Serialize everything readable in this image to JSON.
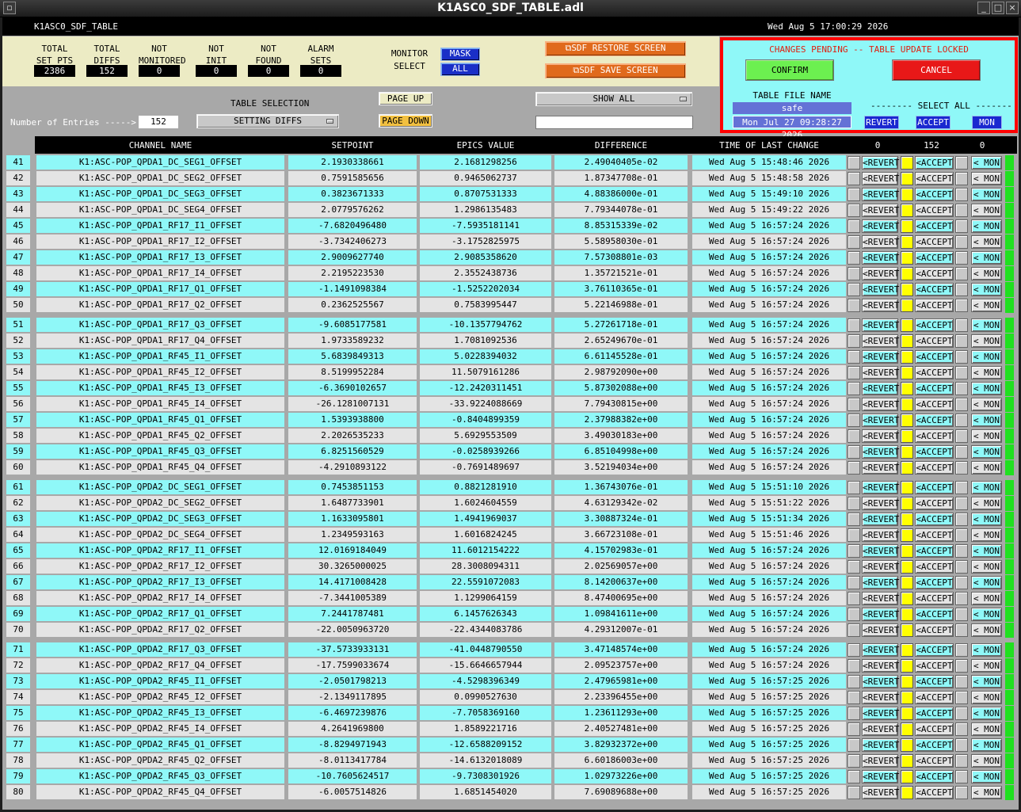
{
  "window": {
    "title": "K1ASC0_SDF_TABLE.adl"
  },
  "header": {
    "screen_name": "K1ASC0_SDF_TABLE",
    "datetime": "Wed Aug  5 17:00:29 2026"
  },
  "stats": [
    {
      "label": "TOTAL\nSET PTS",
      "value": "2386"
    },
    {
      "label": "TOTAL\nDIFFS",
      "value": "152"
    },
    {
      "label": "NOT\nMONITORED",
      "value": "0"
    },
    {
      "label": "NOT\nINIT",
      "value": "0"
    },
    {
      "label": "NOT\nFOUND",
      "value": "0"
    },
    {
      "label": "ALARM\nSETS",
      "value": "0"
    }
  ],
  "monitor": {
    "label": "MONITOR\nSELECT",
    "mask": "MASK",
    "all": "ALL"
  },
  "sdf_buttons": {
    "restore": "SDF RESTORE SCREEN",
    "save": "SDF SAVE SCREEN"
  },
  "pending": {
    "message": "CHANGES PENDING -- TABLE UPDATE LOCKED",
    "confirm": "CONFIRM",
    "cancel": "CANCEL",
    "table_file_label": "TABLE FILE NAME",
    "table_file": "safe",
    "table_file_date": "Mon Jul 27 09:28:27 2026",
    "select_all": "-------- SELECT ALL --------",
    "revert": "REVERT",
    "accept": "ACCEPT",
    "mon": "MON"
  },
  "table_controls": {
    "entries_label": "Number of Entries ----->",
    "entries_value": "152",
    "selection_label": "TABLE SELECTION",
    "selection_value": "SETTING DIFFS",
    "page_up": "PAGE UP",
    "page_down": "PAGE DOWN",
    "show_value": "SHOW ALL",
    "filter_value": ""
  },
  "columns": {
    "name": "CHANNEL NAME",
    "setpoint": "SETPOINT",
    "epics": "EPICS VALUE",
    "difference": "DIFFERENCE",
    "time": "TIME OF LAST CHANGE",
    "count_revert": "0",
    "count_accept": "152",
    "count_mon": "0"
  },
  "row_buttons": {
    "revert": "<REVERT",
    "accept": "<ACCEPT",
    "mon": "< MON"
  },
  "colors": {
    "cyan": "#8ff8f8",
    "gray": "#e4e4e4",
    "yellow": "#ffff00",
    "green": "#20e020",
    "red": "#ff0000",
    "orange": "#e06a1c",
    "blue": "#1a2fc7"
  },
  "rows": [
    {
      "num": "41",
      "name": "K1:ASC-POP_QPDA1_DC_SEG1_OFFSET",
      "setpoint": "2.1930338661",
      "epics": "2.1681298256",
      "diff": "2.49040405e-02",
      "time": "Wed Aug  5 15:48:46 2026",
      "accept": true,
      "rev_on": false,
      "acc_on": true,
      "mon_on": true
    },
    {
      "num": "42",
      "name": "K1:ASC-POP_QPDA1_DC_SEG2_OFFSET",
      "setpoint": "0.7591585656",
      "epics": "0.9465062737",
      "diff": "1.87347708e-01",
      "time": "Wed Aug  5 15:48:58 2026",
      "accept": true,
      "rev_on": false,
      "acc_on": false,
      "mon_on": false
    },
    {
      "num": "43",
      "name": "K1:ASC-POP_QPDA1_DC_SEG3_OFFSET",
      "setpoint": "0.3823671333",
      "epics": "0.8707531333",
      "diff": "4.88386000e-01",
      "time": "Wed Aug  5 15:49:10 2026",
      "accept": true,
      "rev_on": false,
      "acc_on": true,
      "mon_on": true
    },
    {
      "num": "44",
      "name": "K1:ASC-POP_QPDA1_DC_SEG4_OFFSET",
      "setpoint": "2.0779576262",
      "epics": "1.2986135483",
      "diff": "7.79344078e-01",
      "time": "Wed Aug  5 15:49:22 2026",
      "accept": true,
      "rev_on": false,
      "acc_on": false,
      "mon_on": false
    },
    {
      "num": "45",
      "name": "K1:ASC-POP_QPDA1_RF17_I1_OFFSET",
      "setpoint": "-7.6820496480",
      "epics": "-7.5935181141",
      "diff": "8.85315339e-02",
      "time": "Wed Aug  5 16:57:24 2026",
      "accept": true,
      "rev_on": false,
      "acc_on": true,
      "mon_on": true
    },
    {
      "num": "46",
      "name": "K1:ASC-POP_QPDA1_RF17_I2_OFFSET",
      "setpoint": "-3.7342406273",
      "epics": "-3.1752825975",
      "diff": "5.58958030e-01",
      "time": "Wed Aug  5 16:57:24 2026",
      "accept": true,
      "rev_on": false,
      "acc_on": false,
      "mon_on": false
    },
    {
      "num": "47",
      "name": "K1:ASC-POP_QPDA1_RF17_I3_OFFSET",
      "setpoint": "2.9009627740",
      "epics": "2.9085358620",
      "diff": "7.57308801e-03",
      "time": "Wed Aug  5 16:57:24 2026",
      "accept": true,
      "rev_on": false,
      "acc_on": true,
      "mon_on": true
    },
    {
      "num": "48",
      "name": "K1:ASC-POP_QPDA1_RF17_I4_OFFSET",
      "setpoint": "2.2195223530",
      "epics": "2.3552438736",
      "diff": "1.35721521e-01",
      "time": "Wed Aug  5 16:57:24 2026",
      "accept": true,
      "rev_on": false,
      "acc_on": false,
      "mon_on": false
    },
    {
      "num": "49",
      "name": "K1:ASC-POP_QPDA1_RF17_Q1_OFFSET",
      "setpoint": "-1.1491098384",
      "epics": "-1.5252202034",
      "diff": "3.76110365e-01",
      "time": "Wed Aug  5 16:57:24 2026",
      "accept": true,
      "rev_on": false,
      "acc_on": true,
      "mon_on": true
    },
    {
      "num": "50",
      "name": "K1:ASC-POP_QPDA1_RF17_Q2_OFFSET",
      "setpoint": "0.2362525567",
      "epics": "0.7583995447",
      "diff": "5.22146988e-01",
      "time": "Wed Aug  5 16:57:24 2026",
      "accept": true,
      "rev_on": false,
      "acc_on": false,
      "mon_on": false
    },
    {
      "num": "51",
      "name": "K1:ASC-POP_QPDA1_RF17_Q3_OFFSET",
      "setpoint": "-9.6085177581",
      "epics": "-10.1357794762",
      "diff": "5.27261718e-01",
      "time": "Wed Aug  5 16:57:24 2026",
      "accept": true,
      "rev_on": false,
      "acc_on": true,
      "mon_on": true
    },
    {
      "num": "52",
      "name": "K1:ASC-POP_QPDA1_RF17_Q4_OFFSET",
      "setpoint": "1.9733589232",
      "epics": "1.7081092536",
      "diff": "2.65249670e-01",
      "time": "Wed Aug  5 16:57:24 2026",
      "accept": true,
      "rev_on": false,
      "acc_on": false,
      "mon_on": false
    },
    {
      "num": "53",
      "name": "K1:ASC-POP_QPDA1_RF45_I1_OFFSET",
      "setpoint": "5.6839849313",
      "epics": "5.0228394032",
      "diff": "6.61145528e-01",
      "time": "Wed Aug  5 16:57:24 2026",
      "accept": true,
      "rev_on": false,
      "acc_on": true,
      "mon_on": true
    },
    {
      "num": "54",
      "name": "K1:ASC-POP_QPDA1_RF45_I2_OFFSET",
      "setpoint": "8.5199952284",
      "epics": "11.5079161286",
      "diff": "2.98792090e+00",
      "time": "Wed Aug  5 16:57:24 2026",
      "accept": true,
      "rev_on": false,
      "acc_on": false,
      "mon_on": false
    },
    {
      "num": "55",
      "name": "K1:ASC-POP_QPDA1_RF45_I3_OFFSET",
      "setpoint": "-6.3690102657",
      "epics": "-12.2420311451",
      "diff": "5.87302088e+00",
      "time": "Wed Aug  5 16:57:24 2026",
      "accept": true,
      "rev_on": false,
      "acc_on": true,
      "mon_on": true
    },
    {
      "num": "56",
      "name": "K1:ASC-POP_QPDA1_RF45_I4_OFFSET",
      "setpoint": "-26.1281007131",
      "epics": "-33.9224088669",
      "diff": "7.79430815e+00",
      "time": "Wed Aug  5 16:57:24 2026",
      "accept": true,
      "rev_on": false,
      "acc_on": false,
      "mon_on": false
    },
    {
      "num": "57",
      "name": "K1:ASC-POP_QPDA1_RF45_Q1_OFFSET",
      "setpoint": "1.5393938800",
      "epics": "-0.8404899359",
      "diff": "2.37988382e+00",
      "time": "Wed Aug  5 16:57:24 2026",
      "accept": true,
      "rev_on": false,
      "acc_on": true,
      "mon_on": true
    },
    {
      "num": "58",
      "name": "K1:ASC-POP_QPDA1_RF45_Q2_OFFSET",
      "setpoint": "2.2026535233",
      "epics": "5.6929553509",
      "diff": "3.49030183e+00",
      "time": "Wed Aug  5 16:57:24 2026",
      "accept": true,
      "rev_on": false,
      "acc_on": false,
      "mon_on": false
    },
    {
      "num": "59",
      "name": "K1:ASC-POP_QPDA1_RF45_Q3_OFFSET",
      "setpoint": "6.8251560529",
      "epics": "-0.0258939266",
      "diff": "6.85104998e+00",
      "time": "Wed Aug  5 16:57:24 2026",
      "accept": true,
      "rev_on": false,
      "acc_on": true,
      "mon_on": true
    },
    {
      "num": "60",
      "name": "K1:ASC-POP_QPDA1_RF45_Q4_OFFSET",
      "setpoint": "-4.2910893122",
      "epics": "-0.7691489697",
      "diff": "3.52194034e+00",
      "time": "Wed Aug  5 16:57:24 2026",
      "accept": true,
      "rev_on": false,
      "acc_on": false,
      "mon_on": false
    },
    {
      "num": "61",
      "name": "K1:ASC-POP_QPDA2_DC_SEG1_OFFSET",
      "setpoint": "0.7453851153",
      "epics": "0.8821281910",
      "diff": "1.36743076e-01",
      "time": "Wed Aug  5 15:51:10 2026",
      "accept": true,
      "rev_on": false,
      "acc_on": true,
      "mon_on": true
    },
    {
      "num": "62",
      "name": "K1:ASC-POP_QPDA2_DC_SEG2_OFFSET",
      "setpoint": "1.6487733901",
      "epics": "1.6024604559",
      "diff": "4.63129342e-02",
      "time": "Wed Aug  5 15:51:22 2026",
      "accept": true,
      "rev_on": false,
      "acc_on": false,
      "mon_on": false
    },
    {
      "num": "63",
      "name": "K1:ASC-POP_QPDA2_DC_SEG3_OFFSET",
      "setpoint": "1.1633095801",
      "epics": "1.4941969037",
      "diff": "3.30887324e-01",
      "time": "Wed Aug  5 15:51:34 2026",
      "accept": true,
      "rev_on": false,
      "acc_on": true,
      "mon_on": true
    },
    {
      "num": "64",
      "name": "K1:ASC-POP_QPDA2_DC_SEG4_OFFSET",
      "setpoint": "1.2349593163",
      "epics": "1.6016824245",
      "diff": "3.66723108e-01",
      "time": "Wed Aug  5 15:51:46 2026",
      "accept": true,
      "rev_on": false,
      "acc_on": false,
      "mon_on": false
    },
    {
      "num": "65",
      "name": "K1:ASC-POP_QPDA2_RF17_I1_OFFSET",
      "setpoint": "12.0169184049",
      "epics": "11.6012154222",
      "diff": "4.15702983e-01",
      "time": "Wed Aug  5 16:57:24 2026",
      "accept": true,
      "rev_on": false,
      "acc_on": true,
      "mon_on": true
    },
    {
      "num": "66",
      "name": "K1:ASC-POP_QPDA2_RF17_I2_OFFSET",
      "setpoint": "30.3265000025",
      "epics": "28.3008094311",
      "diff": "2.02569057e+00",
      "time": "Wed Aug  5 16:57:24 2026",
      "accept": true,
      "rev_on": false,
      "acc_on": false,
      "mon_on": false
    },
    {
      "num": "67",
      "name": "K1:ASC-POP_QPDA2_RF17_I3_OFFSET",
      "setpoint": "14.4171008428",
      "epics": "22.5591072083",
      "diff": "8.14200637e+00",
      "time": "Wed Aug  5 16:57:24 2026",
      "accept": true,
      "rev_on": false,
      "acc_on": true,
      "mon_on": true
    },
    {
      "num": "68",
      "name": "K1:ASC-POP_QPDA2_RF17_I4_OFFSET",
      "setpoint": "-7.3441005389",
      "epics": "1.1299064159",
      "diff": "8.47400695e+00",
      "time": "Wed Aug  5 16:57:24 2026",
      "accept": true,
      "rev_on": false,
      "acc_on": false,
      "mon_on": false
    },
    {
      "num": "69",
      "name": "K1:ASC-POP_QPDA2_RF17_Q1_OFFSET",
      "setpoint": "7.2441787481",
      "epics": "6.1457626343",
      "diff": "1.09841611e+00",
      "time": "Wed Aug  5 16:57:24 2026",
      "accept": true,
      "rev_on": false,
      "acc_on": true,
      "mon_on": true
    },
    {
      "num": "70",
      "name": "K1:ASC-POP_QPDA2_RF17_Q2_OFFSET",
      "setpoint": "-22.0050963720",
      "epics": "-22.4344083786",
      "diff": "4.29312007e-01",
      "time": "Wed Aug  5 16:57:24 2026",
      "accept": true,
      "rev_on": false,
      "acc_on": false,
      "mon_on": false
    },
    {
      "num": "71",
      "name": "K1:ASC-POP_QPDA2_RF17_Q3_OFFSET",
      "setpoint": "-37.5733933131",
      "epics": "-41.0448790550",
      "diff": "3.47148574e+00",
      "time": "Wed Aug  5 16:57:24 2026",
      "accept": true,
      "rev_on": false,
      "acc_on": true,
      "mon_on": true
    },
    {
      "num": "72",
      "name": "K1:ASC-POP_QPDA2_RF17_Q4_OFFSET",
      "setpoint": "-17.7599033674",
      "epics": "-15.6646657944",
      "diff": "2.09523757e+00",
      "time": "Wed Aug  5 16:57:24 2026",
      "accept": true,
      "rev_on": false,
      "acc_on": false,
      "mon_on": false
    },
    {
      "num": "73",
      "name": "K1:ASC-POP_QPDA2_RF45_I1_OFFSET",
      "setpoint": "-2.0501798213",
      "epics": "-4.5298396349",
      "diff": "2.47965981e+00",
      "time": "Wed Aug  5 16:57:25 2026",
      "accept": true,
      "rev_on": false,
      "acc_on": true,
      "mon_on": true
    },
    {
      "num": "74",
      "name": "K1:ASC-POP_QPDA2_RF45_I2_OFFSET",
      "setpoint": "-2.1349117895",
      "epics": "0.0990527630",
      "diff": "2.23396455e+00",
      "time": "Wed Aug  5 16:57:25 2026",
      "accept": true,
      "rev_on": false,
      "acc_on": false,
      "mon_on": false
    },
    {
      "num": "75",
      "name": "K1:ASC-POP_QPDA2_RF45_I3_OFFSET",
      "setpoint": "-6.4697239876",
      "epics": "-7.7058369160",
      "diff": "1.23611293e+00",
      "time": "Wed Aug  5 16:57:25 2026",
      "accept": true,
      "rev_on": false,
      "acc_on": true,
      "mon_on": true
    },
    {
      "num": "76",
      "name": "K1:ASC-POP_QPDA2_RF45_I4_OFFSET",
      "setpoint": "4.2641969800",
      "epics": "1.8589221716",
      "diff": "2.40527481e+00",
      "time": "Wed Aug  5 16:57:25 2026",
      "accept": true,
      "rev_on": false,
      "acc_on": false,
      "mon_on": false
    },
    {
      "num": "77",
      "name": "K1:ASC-POP_QPDA2_RF45_Q1_OFFSET",
      "setpoint": "-8.8294971943",
      "epics": "-12.6588209152",
      "diff": "3.82932372e+00",
      "time": "Wed Aug  5 16:57:25 2026",
      "accept": true,
      "rev_on": false,
      "acc_on": true,
      "mon_on": true
    },
    {
      "num": "78",
      "name": "K1:ASC-POP_QPDA2_RF45_Q2_OFFSET",
      "setpoint": "-8.0113417784",
      "epics": "-14.6132018089",
      "diff": "6.60186003e+00",
      "time": "Wed Aug  5 16:57:25 2026",
      "accept": true,
      "rev_on": false,
      "acc_on": false,
      "mon_on": false
    },
    {
      "num": "79",
      "name": "K1:ASC-POP_QPDA2_RF45_Q3_OFFSET",
      "setpoint": "-10.7605624517",
      "epics": "-9.7308301926",
      "diff": "1.02973226e+00",
      "time": "Wed Aug  5 16:57:25 2026",
      "accept": true,
      "rev_on": false,
      "acc_on": true,
      "mon_on": true
    },
    {
      "num": "80",
      "name": "K1:ASC-POP_QPDA2_RF45_Q4_OFFSET",
      "setpoint": "-6.0057514826",
      "epics": "1.6851454020",
      "diff": "7.69089688e+00",
      "time": "Wed Aug  5 16:57:25 2026",
      "accept": true,
      "rev_on": false,
      "acc_on": false,
      "mon_on": false
    }
  ]
}
